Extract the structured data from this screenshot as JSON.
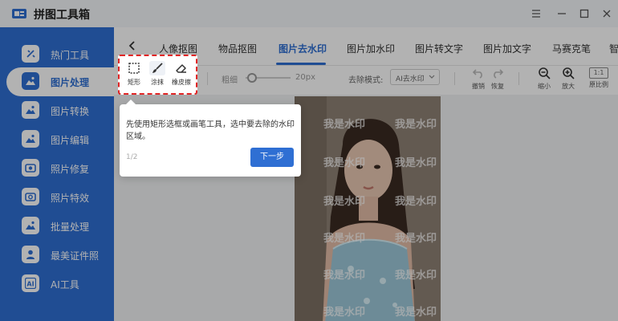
{
  "app": {
    "title": "拼图工具箱"
  },
  "sidebar": {
    "items": [
      {
        "label": "热门工具",
        "icon": "toolbox-icon"
      },
      {
        "label": "图片处理",
        "icon": "image-edit-icon",
        "active": true
      },
      {
        "label": "图片转换",
        "icon": "image-convert-icon"
      },
      {
        "label": "图片编辑",
        "icon": "image-pencil-icon"
      },
      {
        "label": "照片修复",
        "icon": "photo-repair-icon"
      },
      {
        "label": "照片特效",
        "icon": "photo-effect-icon"
      },
      {
        "label": "批量处理",
        "icon": "batch-icon"
      },
      {
        "label": "最美证件照",
        "icon": "id-photo-icon"
      },
      {
        "label": "AI工具",
        "icon": "ai-icon"
      }
    ]
  },
  "tabs": [
    {
      "label": "人像抠图"
    },
    {
      "label": "物品抠图"
    },
    {
      "label": "图片去水印",
      "active": true
    },
    {
      "label": "图片加水印"
    },
    {
      "label": "图片转文字"
    },
    {
      "label": "图片加文字"
    },
    {
      "label": "马赛克笔"
    },
    {
      "label": "智"
    }
  ],
  "toolbar": {
    "tools": [
      {
        "label": "矩形",
        "icon": "rectangle-select-icon"
      },
      {
        "label": "涂抹",
        "icon": "brush-icon"
      },
      {
        "label": "橡皮擦",
        "icon": "eraser-icon"
      }
    ],
    "brush_label": "粗细",
    "brush_value": "20px",
    "brush_level": 0.15,
    "mode_label": "去除模式:",
    "mode_value": "AI去水印",
    "undo_label": "撤销",
    "redo_label": "恢复",
    "zoom_out_label": "缩小",
    "zoom_in_label": "放大",
    "ratio_badge": "1:1",
    "ratio_label": "原比例"
  },
  "canvas": {
    "watermark_text": "我是水印"
  },
  "tooltip": {
    "text": "先使用矩形选框或画笔工具，选中要去除的水印区域。",
    "page": "1/2",
    "next_label": "下一步"
  },
  "colors": {
    "accent": "#2f6fd3",
    "highlight_border": "#e02424"
  }
}
